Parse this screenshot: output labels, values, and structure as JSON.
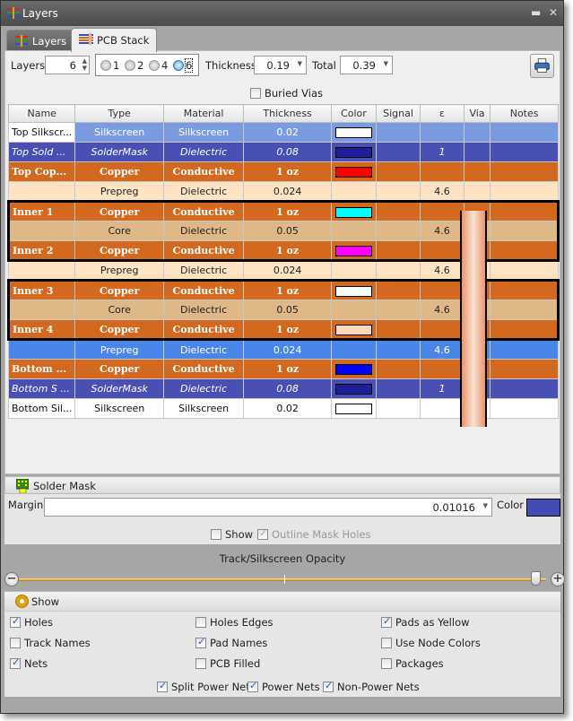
{
  "window": {
    "title": "Layers",
    "title_icon": "layers-icon",
    "controls": [
      "restore-icon",
      "close-icon"
    ]
  },
  "tabs": [
    {
      "label": "Layers",
      "icon": "layers-icon",
      "active": false
    },
    {
      "label": "PCB Stack",
      "icon": "pcb-stack-icon",
      "active": true
    }
  ],
  "toolbar": {
    "layers_label": "Layers",
    "layers_value": "6",
    "layer_options": [
      "1",
      "2",
      "4",
      "6"
    ],
    "layer_selected": "6",
    "thickness_label": "Thickness",
    "thickness_value": "0.19",
    "total_label": "Total",
    "total_value": "0.39",
    "print_icon": "printer-icon",
    "buried_vias_label": "Buried Vias",
    "buried_vias_checked": false
  },
  "grid": {
    "columns": [
      "Name",
      "Type",
      "Material",
      "Thickness",
      "Color",
      "Signal",
      "ε",
      "Via",
      "Notes"
    ],
    "rows": [
      {
        "name": "Top Silkscr...",
        "type": "Silkscreen",
        "material": "Silkscreen",
        "thickness": "0.02",
        "color": "#ffffff",
        "signal": "",
        "eps": "",
        "notes": "",
        "style": "silk-top"
      },
      {
        "name": "Top Sold ...",
        "type": "SolderMask",
        "material": "Dielectric",
        "thickness": "0.08",
        "color": "#1a1f9c",
        "signal": "",
        "eps": "1",
        "notes": "",
        "style": "mask"
      },
      {
        "name": "Top Cop...",
        "type": "Copper",
        "material": "Conductive",
        "thickness": "1 oz",
        "color": "#ff0000",
        "signal": "",
        "eps": "",
        "notes": "",
        "style": "copper"
      },
      {
        "name": "",
        "type": "Prepreg",
        "material": "Dielectric",
        "thickness": "0.024",
        "color": "",
        "signal": "",
        "eps": "4.6",
        "notes": "",
        "style": "prepreg"
      },
      {
        "name": "Inner 1",
        "type": "Copper",
        "material": "Conductive",
        "thickness": "1 oz",
        "color": "#00ffff",
        "signal": "",
        "eps": "",
        "notes": "",
        "style": "copper"
      },
      {
        "name": "",
        "type": "Core",
        "material": "Dielectric",
        "thickness": "0.05",
        "color": "",
        "signal": "",
        "eps": "4.6",
        "notes": "",
        "style": "core"
      },
      {
        "name": "Inner 2",
        "type": "Copper",
        "material": "Conductive",
        "thickness": "1 oz",
        "color": "#ff00ff",
        "signal": "",
        "eps": "",
        "notes": "",
        "style": "copper"
      },
      {
        "name": "",
        "type": "Prepreg",
        "material": "Dielectric",
        "thickness": "0.024",
        "color": "",
        "signal": "",
        "eps": "4.6",
        "notes": "",
        "style": "prepreg"
      },
      {
        "name": "Inner 3",
        "type": "Copper",
        "material": "Conductive",
        "thickness": "1 oz",
        "color": "#f5fffa",
        "signal": "",
        "eps": "",
        "notes": "",
        "style": "copper"
      },
      {
        "name": "",
        "type": "Core",
        "material": "Dielectric",
        "thickness": "0.05",
        "color": "",
        "signal": "",
        "eps": "4.6",
        "notes": "",
        "style": "core"
      },
      {
        "name": "Inner 4",
        "type": "Copper",
        "material": "Conductive",
        "thickness": "1 oz",
        "color": "#ffdab9",
        "signal": "",
        "eps": "",
        "notes": "",
        "style": "copper"
      },
      {
        "name": "",
        "type": "Prepreg",
        "material": "Dielectric",
        "thickness": "0.024",
        "color": "",
        "signal": "",
        "eps": "4.6",
        "notes": "",
        "style": "prepreg-sel"
      },
      {
        "name": "Bottom ...",
        "type": "Copper",
        "material": "Conductive",
        "thickness": "1 oz",
        "color": "#0000ff",
        "signal": "",
        "eps": "",
        "notes": "",
        "style": "copper"
      },
      {
        "name": "Bottom S ...",
        "type": "SolderMask",
        "material": "Dielectric",
        "thickness": "0.08",
        "color": "#1a1f9c",
        "signal": "",
        "eps": "1",
        "notes": "",
        "style": "mask"
      },
      {
        "name": "Bottom Sil...",
        "type": "Silkscreen",
        "material": "Silkscreen",
        "thickness": "0.02",
        "color": "#ffffff",
        "signal": "",
        "eps": "",
        "notes": "",
        "style": "silk-bot"
      }
    ]
  },
  "solder_mask": {
    "title": "Solder Mask",
    "icon": "solder-mask-chip-icon",
    "margin_label": "Margin",
    "margin_value": "0.01016",
    "color_label": "Color",
    "color_value": "#444cb4",
    "show_label": "Show",
    "show_checked": false,
    "outline_label": "Outline Mask Holes",
    "outline_checked": true,
    "outline_disabled": true
  },
  "opacity": {
    "label": "Track/Silkscreen Opacity",
    "value_fraction": 0.98
  },
  "show": {
    "title": "Show",
    "options": [
      {
        "label": "Holes",
        "checked": true
      },
      {
        "label": "Holes Edges",
        "checked": false
      },
      {
        "label": "Pads as Yellow",
        "checked": true
      },
      {
        "label": "Track Names",
        "checked": false
      },
      {
        "label": "Pad Names",
        "checked": true
      },
      {
        "label": "Use Node Colors",
        "checked": false
      },
      {
        "label": "Nets",
        "checked": true
      },
      {
        "label": "PCB Filled",
        "checked": false
      },
      {
        "label": "Packages",
        "checked": false
      }
    ],
    "net_options": [
      {
        "label": "Split Power Nets",
        "checked": true
      },
      {
        "label": "Power Nets",
        "checked": true
      },
      {
        "label": "Non-Power Nets",
        "checked": true
      }
    ]
  }
}
